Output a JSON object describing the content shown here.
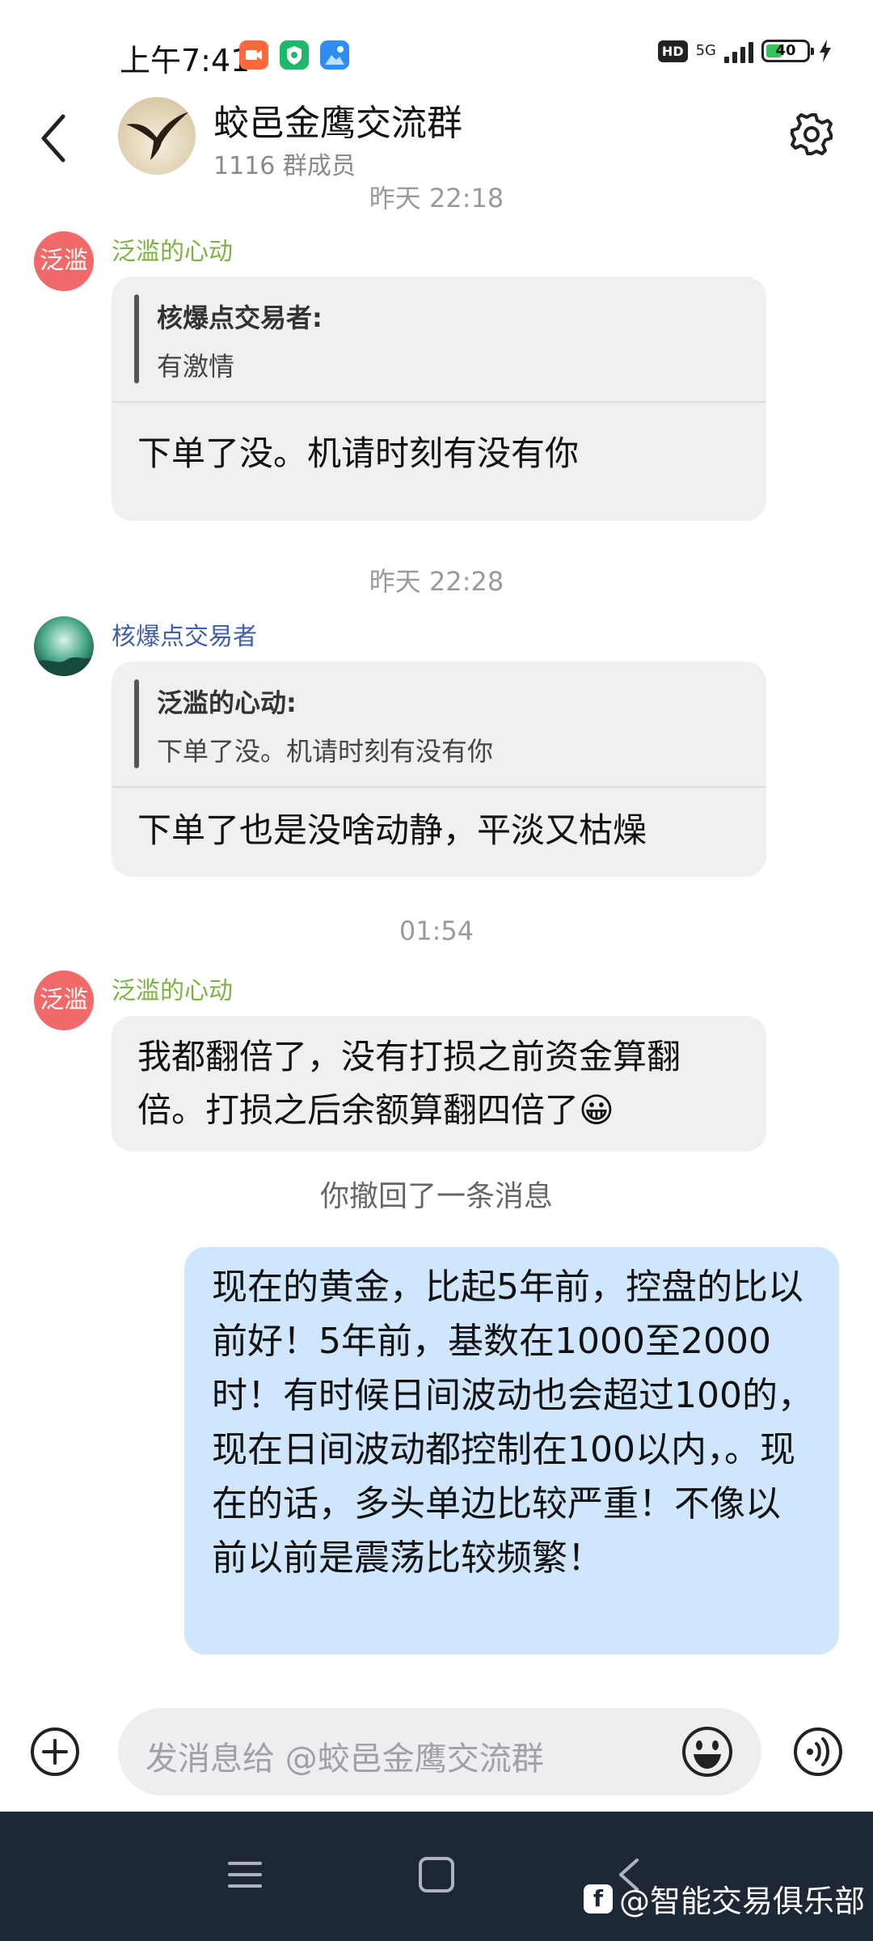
{
  "status_bar": {
    "time": "上午7:41",
    "hd": "HD",
    "network": "5G",
    "battery": "40",
    "battery_level": 0.4
  },
  "header": {
    "title": "蛟邑金鹰交流群",
    "members": "1116 群成员"
  },
  "chat": {
    "top_timestamp": "昨天 22:18",
    "messages": [
      {
        "sender": "泛滥的心动",
        "sender_color": "#7cb342",
        "avatar_text": "泛滥",
        "quote_name": "核爆点交易者:",
        "quote_text": "有激情",
        "text": "下单了没。机请时刻有没有你"
      },
      {
        "timestamp": "昨天 22:28",
        "sender": "核爆点交易者",
        "sender_color": "#3f5fa8",
        "quote_name": "泛滥的心动:",
        "quote_text": "下单了没。机请时刻有没有你",
        "text": "下单了也是没啥动静，平淡又枯燥"
      },
      {
        "timestamp": "01:54",
        "sender": "泛滥的心动",
        "sender_color": "#7cb342",
        "avatar_text": "泛滥",
        "text": "我都翻倍了，没有打损之前资金算翻倍。打损之后余额算翻四倍了😀"
      }
    ],
    "recall_notice": "你撤回了一条消息",
    "my_message": "现在的黄金，比起5年前，控盘的比以前好！5年前，基数在1000至2000时！有时候日间波动也会超过100的，现在日间波动都控制在100以内，。现在的话，多头单边比较严重！不像以前以前是震荡比较频繁！"
  },
  "input": {
    "placeholder": "发消息给  @蛟邑金鹰交流群"
  },
  "watermark": {
    "text": "@智能交易俱乐部"
  }
}
